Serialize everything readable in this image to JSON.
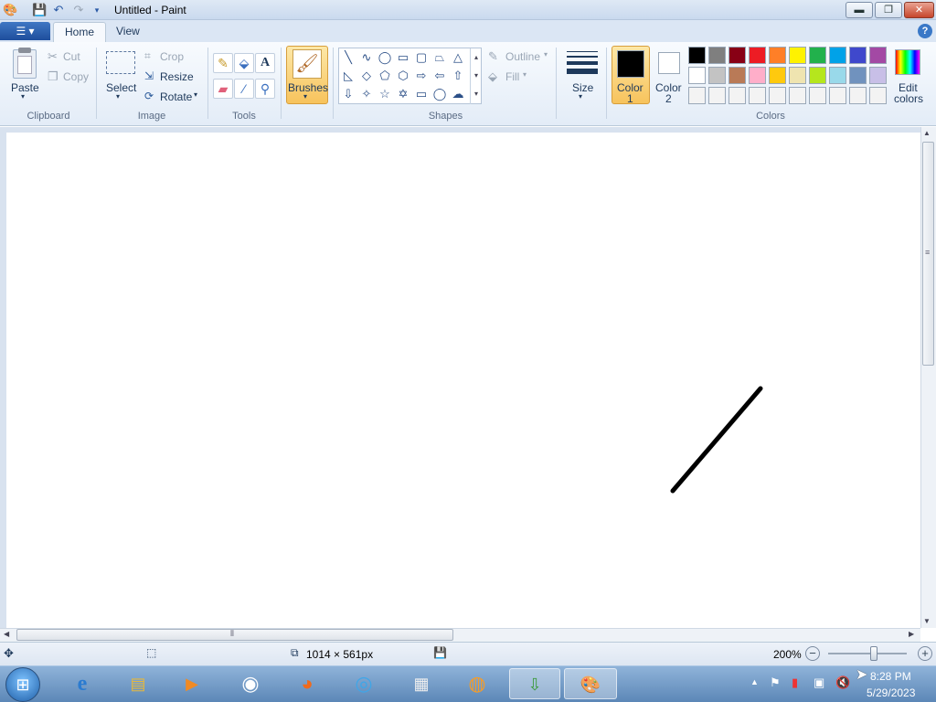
{
  "window": {
    "title": "Untitled - Paint"
  },
  "tabs": {
    "file_icon": "paint-menu-icon",
    "home": "Home",
    "view": "View"
  },
  "clipboard": {
    "paste": "Paste",
    "cut": "Cut",
    "copy": "Copy",
    "group": "Clipboard"
  },
  "image": {
    "select": "Select",
    "crop": "Crop",
    "resize": "Resize",
    "rotate": "Rotate",
    "group": "Image"
  },
  "tools": {
    "group": "Tools",
    "items": [
      "pencil-icon",
      "fill-icon",
      "text-icon",
      "eraser-icon",
      "color-picker-icon",
      "magnifier-icon"
    ]
  },
  "brushes": {
    "label": "Brushes"
  },
  "shapes": {
    "group": "Shapes",
    "outline": "Outline",
    "fill": "Fill"
  },
  "size": {
    "label": "Size"
  },
  "colors": {
    "color1_label": "Color",
    "color1_num": "1",
    "color2_label": "Color",
    "color2_num": "2",
    "edit_label": "Edit",
    "edit_label2": "colors",
    "group": "Colors",
    "color1": "#000000",
    "color2": "#ffffff",
    "row1": [
      "#000000",
      "#7f7f7f",
      "#880015",
      "#ed1c24",
      "#ff7f27",
      "#fff200",
      "#22b14c",
      "#00a2e8",
      "#3f48cc",
      "#a349a4"
    ],
    "row2": [
      "#ffffff",
      "#c3c3c3",
      "#b97a57",
      "#ffaec9",
      "#ffc90e",
      "#efe4b0",
      "#b5e61d",
      "#99d9ea",
      "#7092be",
      "#c8bfe7"
    ],
    "row3": [
      "#f3f3f3",
      "#f3f3f3",
      "#f3f3f3",
      "#f3f3f3",
      "#f3f3f3",
      "#f3f3f3",
      "#f3f3f3",
      "#f3f3f3",
      "#f3f3f3",
      "#f3f3f3"
    ]
  },
  "status": {
    "canvas_size": "1014 × 561px",
    "zoom": "200%"
  },
  "taskbar": {
    "time": "8:28 PM",
    "date": "5/29/2023"
  }
}
